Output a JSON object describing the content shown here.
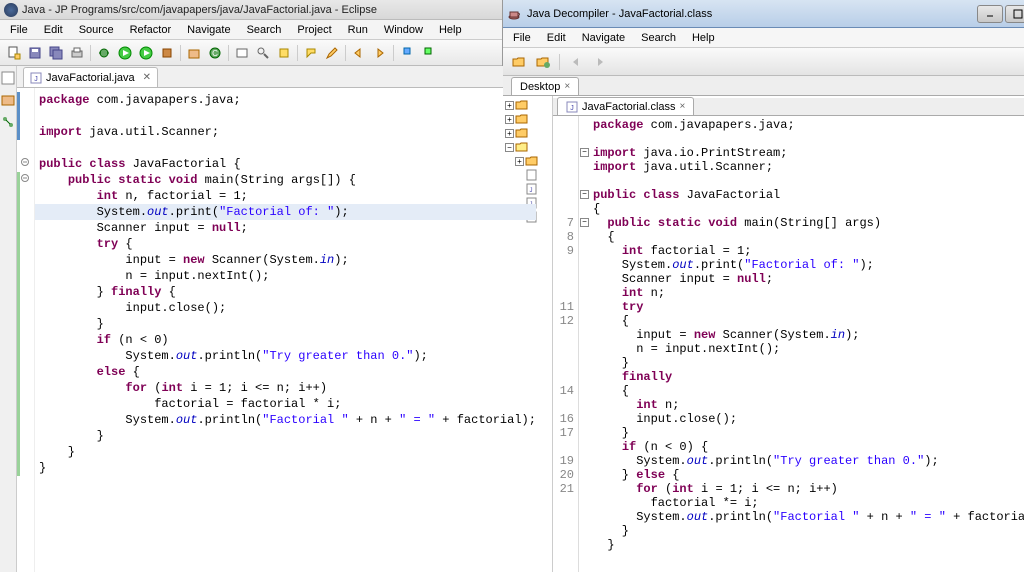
{
  "eclipse": {
    "title": "Java - JP Programs/src/com/javapapers/java/JavaFactorial.java - Eclipse",
    "menu": [
      "File",
      "Edit",
      "Source",
      "Refactor",
      "Navigate",
      "Search",
      "Project",
      "Run",
      "Window",
      "Help"
    ],
    "tab": "JavaFactorial.java",
    "code": [
      "package com.javapapers.java;",
      "",
      "import java.util.Scanner;",
      "",
      "public class JavaFactorial {",
      "    public static void main(String args[]) {",
      "        int n, factorial = 1;",
      "        System.out.print(\"Factorial of: \");",
      "        Scanner input = null;",
      "        try {",
      "            input = new Scanner(System.in);",
      "            n = input.nextInt();",
      "        } finally {",
      "            input.close();",
      "        }",
      "        if (n < 0)",
      "            System.out.println(\"Try greater than 0.\");",
      "        else {",
      "            for (int i = 1; i <= n; i++)",
      "                factorial = factorial * i;",
      "            System.out.println(\"Factorial \" + n + \" = \" + factorial);",
      "        }",
      "    }",
      "}"
    ],
    "highlighted_line_index": 7
  },
  "jd": {
    "title": "Java Decompiler - JavaFactorial.class",
    "menu": [
      "File",
      "Edit",
      "Navigate",
      "Search",
      "Help"
    ],
    "desktop_tab": "Desktop",
    "file_tab": "JavaFactorial.class",
    "line_numbers": [
      "",
      "",
      "",
      "",
      "",
      "",
      "",
      "7",
      "8",
      "9",
      "",
      "",
      "",
      "11",
      "12",
      "",
      "",
      "",
      "",
      "14",
      "",
      "16",
      "17",
      "",
      "19",
      "20",
      "21",
      "",
      "",
      "",
      ""
    ],
    "code": [
      "package com.javapapers.java;",
      "",
      "import java.io.PrintStream;",
      "import java.util.Scanner;",
      "",
      "public class JavaFactorial",
      "{",
      "  public static void main(String[] args)",
      "  {",
      "    int factorial = 1;",
      "    System.out.print(\"Factorial of: \");",
      "    Scanner input = null;",
      "    int n;",
      "    try",
      "    {",
      "      input = new Scanner(System.in);",
      "      n = input.nextInt();",
      "    }",
      "    finally",
      "    {",
      "      int n;",
      "      input.close();",
      "    }",
      "    if (n < 0) {",
      "      System.out.println(\"Try greater than 0.\");",
      "    } else {",
      "      for (int i = 1; i <= n; i++)",
      "        factorial *= i;",
      "      System.out.println(\"Factorial \" + n + \" = \" + factorial);",
      "    }",
      "  }"
    ]
  }
}
